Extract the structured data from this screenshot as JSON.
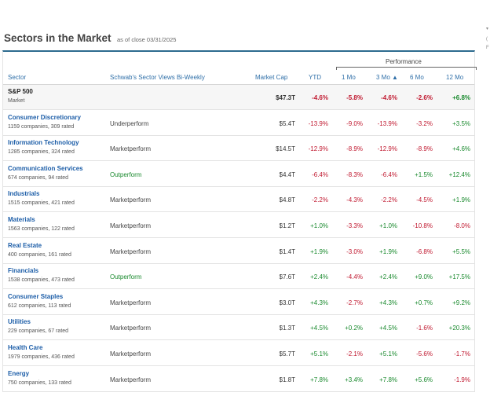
{
  "title": "Sectors in the Market",
  "as_of": "as of close 03/31/2025",
  "edge_fragments": [
    "▾",
    "(",
    "F"
  ],
  "headers": {
    "performance": "Performance",
    "sector": "Sector",
    "views": "Schwab's Sector Views Bi-Weekly",
    "market_cap": "Market Cap",
    "ytd": "YTD",
    "m1": "1 Mo",
    "m3": "3 Mo ▲",
    "m6": "6 Mo",
    "m12": "12 Mo"
  },
  "rows": [
    {
      "name": "S&P 500",
      "sub": "Market",
      "view": "",
      "cap": "$47.3T",
      "ytd": "-4.6%",
      "m1": "-5.8%",
      "m3": "-4.6%",
      "m6": "-2.6%",
      "m12": "+6.8%"
    },
    {
      "name": "Consumer Discretionary",
      "sub": "1159 companies, 309 rated",
      "view": "Underperform",
      "cap": "$5.4T",
      "ytd": "-13.9%",
      "m1": "-9.0%",
      "m3": "-13.9%",
      "m6": "-3.2%",
      "m12": "+3.5%"
    },
    {
      "name": "Information Technology",
      "sub": "1285 companies, 324 rated",
      "view": "Marketperform",
      "cap": "$14.5T",
      "ytd": "-12.9%",
      "m1": "-8.9%",
      "m3": "-12.9%",
      "m6": "-8.9%",
      "m12": "+4.6%"
    },
    {
      "name": "Communication Services",
      "sub": "674 companies, 94 rated",
      "view": "Outperform",
      "cap": "$4.4T",
      "ytd": "-6.4%",
      "m1": "-8.3%",
      "m3": "-6.4%",
      "m6": "+1.5%",
      "m12": "+12.4%"
    },
    {
      "name": "Industrials",
      "sub": "1515 companies, 421 rated",
      "view": "Marketperform",
      "cap": "$4.8T",
      "ytd": "-2.2%",
      "m1": "-4.3%",
      "m3": "-2.2%",
      "m6": "-4.5%",
      "m12": "+1.9%"
    },
    {
      "name": "Materials",
      "sub": "1563 companies, 122 rated",
      "view": "Marketperform",
      "cap": "$1.2T",
      "ytd": "+1.0%",
      "m1": "-3.3%",
      "m3": "+1.0%",
      "m6": "-10.8%",
      "m12": "-8.0%"
    },
    {
      "name": "Real Estate",
      "sub": "400 companies, 161 rated",
      "view": "Marketperform",
      "cap": "$1.4T",
      "ytd": "+1.9%",
      "m1": "-3.0%",
      "m3": "+1.9%",
      "m6": "-6.8%",
      "m12": "+5.5%"
    },
    {
      "name": "Financials",
      "sub": "1538 companies, 473 rated",
      "view": "Outperform",
      "cap": "$7.6T",
      "ytd": "+2.4%",
      "m1": "-4.4%",
      "m3": "+2.4%",
      "m6": "+9.0%",
      "m12": "+17.5%"
    },
    {
      "name": "Consumer Staples",
      "sub": "612 companies, 113 rated",
      "view": "Marketperform",
      "cap": "$3.0T",
      "ytd": "+4.3%",
      "m1": "-2.7%",
      "m3": "+4.3%",
      "m6": "+0.7%",
      "m12": "+9.2%"
    },
    {
      "name": "Utilities",
      "sub": "229 companies, 67 rated",
      "view": "Marketperform",
      "cap": "$1.3T",
      "ytd": "+4.5%",
      "m1": "+0.2%",
      "m3": "+4.5%",
      "m6": "-1.6%",
      "m12": "+20.3%"
    },
    {
      "name": "Health Care",
      "sub": "1979 companies, 436 rated",
      "view": "Marketperform",
      "cap": "$5.7T",
      "ytd": "+5.1%",
      "m1": "-2.1%",
      "m3": "+5.1%",
      "m6": "-5.6%",
      "m12": "-1.7%"
    },
    {
      "name": "Energy",
      "sub": "750 companies, 133 rated",
      "view": "Marketperform",
      "cap": "$1.8T",
      "ytd": "+7.8%",
      "m1": "+3.4%",
      "m3": "+7.8%",
      "m6": "+5.6%",
      "m12": "-1.9%"
    }
  ]
}
